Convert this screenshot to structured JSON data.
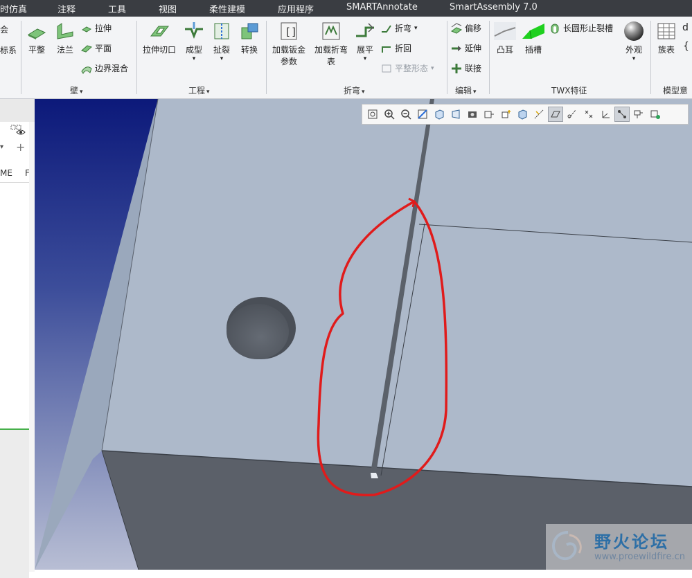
{
  "menu": {
    "items": [
      "时仿真",
      "注释",
      "工具",
      "视图",
      "柔性建模",
      "应用程序",
      "SMARTAnnotate",
      "SmartAssembly 7.0"
    ]
  },
  "ribbon": {
    "cut_top": "会",
    "cut_bottom": "标系",
    "wall": {
      "flat": "平整",
      "flange": "法兰",
      "extrude": "拉伸",
      "planar": "平面",
      "boundary_blend": "边界混合",
      "group": "壁"
    },
    "engineering": {
      "extrude_cut": "拉伸切口",
      "form": "成型",
      "rip": "扯裂",
      "convert": "转换",
      "group": "工程"
    },
    "bend": {
      "load_sheet_params": [
        "加载钣金",
        "参数"
      ],
      "load_bend_table": [
        "加载折弯",
        "表"
      ],
      "unbend": "展平",
      "bend": "折弯",
      "bend_back": "折回",
      "flat_state": "平整形态",
      "group": "折弯"
    },
    "edit": {
      "offset": "偏移",
      "extend": "延伸",
      "join": "联接",
      "group": "编辑"
    },
    "twx": {
      "convex_tab": "凸耳",
      "slot": "插槽",
      "oblong_relief": "长圆形止裂槽",
      "appearance": "外观",
      "group": "TWX特征"
    },
    "model": {
      "family_table": "族表",
      "group": "模型意",
      "cut_a": "d",
      "cut_b": "{"
    }
  },
  "left_panel": {
    "col_a": "ME",
    "col_b": "F",
    "plus": "+"
  },
  "viewport": {
    "colors": {
      "top_face": "#adb9ca",
      "front_face": "#5b6069",
      "left_face": "#9aa8bc",
      "annotation": "#e01b1b"
    }
  },
  "view_toolbar": {
    "icons": [
      "refit-icon",
      "zoom-in-icon",
      "zoom-out-icon",
      "repaint-icon",
      "shading-icon",
      "perspective-icon",
      "saved-views-icon",
      "view-manager-icon",
      "orient-icon",
      "display-style-icon",
      "datum-display-icon",
      "plane-display-icon",
      "axis-display-icon",
      "point-display-icon",
      "csys-display-icon",
      "annotation-display-icon",
      "spin-center-icon",
      "appearance-icon"
    ]
  },
  "watermark": {
    "title": "野火论坛",
    "url": "www.proewildfire.cn"
  }
}
